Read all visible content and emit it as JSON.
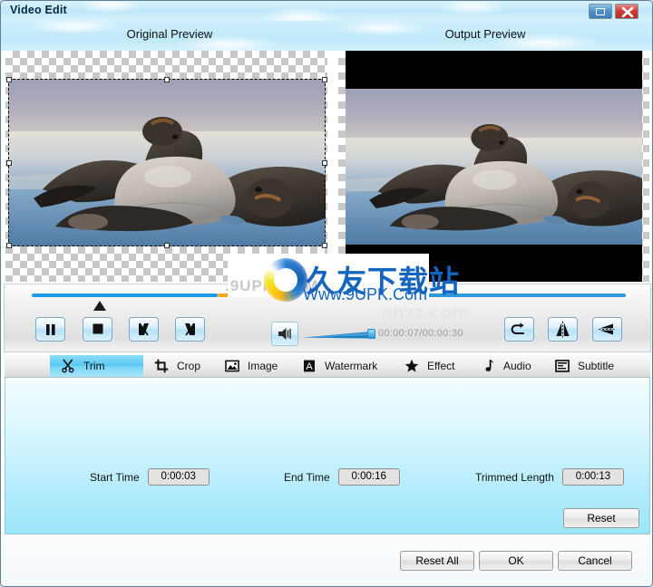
{
  "window": {
    "title": "Video Edit",
    "maximize_label": "Maximize",
    "close_label": "Close"
  },
  "previews": {
    "original_label": "Original Preview",
    "output_label": "Output Preview"
  },
  "player": {
    "timecode": "00:00:07/00:00:30",
    "current_time": "00:00:07",
    "total_time": "00:00:30",
    "pause_label": "Pause",
    "stop_label": "Stop",
    "set_start_label": "Set Start",
    "set_end_label": "Set End",
    "rotate_label": "Rotate",
    "flip_horizontal_label": "Flip Horizontal",
    "flip_vertical_label": "Flip Vertical",
    "volume_label": "Volume"
  },
  "tabs": [
    {
      "label": "Trim",
      "icon": "scissors-icon",
      "active": true
    },
    {
      "label": "Crop",
      "icon": "crop-icon",
      "active": false
    },
    {
      "label": "Image",
      "icon": "image-icon",
      "active": false
    },
    {
      "label": "Watermark",
      "icon": "watermark-icon",
      "active": false
    },
    {
      "label": "Effect",
      "icon": "star-icon",
      "active": false
    },
    {
      "label": "Audio",
      "icon": "music-note-icon",
      "active": false
    },
    {
      "label": "Subtitle",
      "icon": "subtitle-icon",
      "active": false
    }
  ],
  "trim": {
    "start_time_label": "Start Time",
    "start_time_value": "0:00:03",
    "end_time_label": "End Time",
    "end_time_value": "0:00:16",
    "trimmed_length_label": "Trimmed Length",
    "trimmed_length_value": "0:00:13",
    "reset_label": "Reset"
  },
  "footer": {
    "reset_all_label": "Reset All",
    "ok_label": "OK",
    "cancel_label": "Cancel"
  },
  "watermark": {
    "brand_cn": "久友下载站",
    "url": "Www.9UPK.Com",
    "small_url": ".9UPK.COM",
    "ghost": "anxz.com"
  },
  "colors": {
    "titlebar_sky": "#bfe8fa",
    "accent_blue": "#1e9ae6",
    "trim_orange": "#f5a81c",
    "panel_cyan": "#9ce5fa",
    "close_red": "#cc3b33",
    "active_tab": "#57c8f2"
  }
}
